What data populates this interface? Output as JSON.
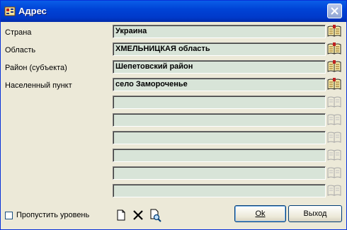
{
  "window": {
    "title": "Адрес",
    "close_icon": "close-icon"
  },
  "rows": [
    {
      "label": "Страна",
      "value": "Украина",
      "book_enabled": true
    },
    {
      "label": "Область",
      "value": "ХМЕЛЬНИЦКАЯ область",
      "book_enabled": true
    },
    {
      "label": "Район (субъекта)",
      "value": "Шепетовский район",
      "book_enabled": true
    },
    {
      "label": "Населенный пункт",
      "value": "село Замороченье",
      "book_enabled": true
    },
    {
      "label": "",
      "value": "",
      "book_enabled": false
    },
    {
      "label": "",
      "value": "",
      "book_enabled": false
    },
    {
      "label": "",
      "value": "",
      "book_enabled": false
    },
    {
      "label": "",
      "value": "",
      "book_enabled": false
    },
    {
      "label": "",
      "value": "",
      "book_enabled": false
    },
    {
      "label": "",
      "value": "",
      "book_enabled": false
    }
  ],
  "footer": {
    "skip_level_label": "Пропустить уровень",
    "skip_level_checked": false,
    "ok_label": "Ok",
    "exit_label": "Выход"
  },
  "colors": {
    "titlebar": "#0043d6",
    "field_bg": "#d8e4d8",
    "window_bg": "#ece9d8"
  }
}
